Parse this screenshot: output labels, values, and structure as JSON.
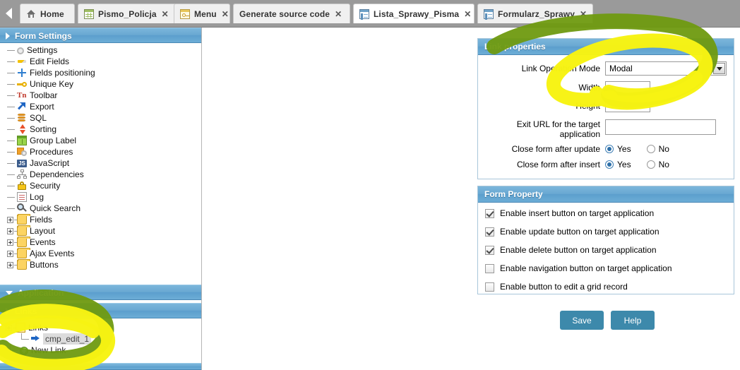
{
  "tabbar": {
    "scroll_left_icon": "triangle-left-icon",
    "tabs": [
      {
        "label": "Home",
        "icon": "home-icon",
        "closable": false,
        "active": false
      },
      {
        "label": "Pismo_Policja",
        "icon": "grid-icon",
        "closable": true,
        "active": false
      },
      {
        "label": "Menu",
        "icon": "menu-icon",
        "closable": true,
        "active": false
      },
      {
        "label": "Generate source code",
        "icon": "none",
        "closable": true,
        "active": false
      },
      {
        "label": "Lista_Sprawy_Pisma",
        "icon": "form-icon",
        "closable": true,
        "active": true
      },
      {
        "label": "Formularz_Sprawy",
        "icon": "form-icon",
        "closable": true,
        "active": false
      }
    ],
    "close_glyph": "✕"
  },
  "sidebar": {
    "sections": [
      {
        "title": "Form Settings",
        "expanded": true
      },
      {
        "title": "Application",
        "expanded": true
      },
      {
        "title": "Links",
        "expanded": false
      }
    ],
    "form_settings_items": [
      {
        "label": "Settings",
        "icon": "gear-icon",
        "type": "leaf"
      },
      {
        "label": "Edit Fields",
        "icon": "pencil-icon",
        "type": "leaf"
      },
      {
        "label": "Fields positioning",
        "icon": "move-icon",
        "type": "leaf"
      },
      {
        "label": "Unique Key",
        "icon": "key-icon",
        "type": "leaf"
      },
      {
        "label": "Toolbar",
        "icon": "toolbar-icon",
        "type": "leaf"
      },
      {
        "label": "Export",
        "icon": "export-arrow-icon",
        "type": "leaf"
      },
      {
        "label": "SQL",
        "icon": "database-icon",
        "type": "leaf"
      },
      {
        "label": "Sorting",
        "icon": "sort-icon",
        "type": "leaf"
      },
      {
        "label": "Group Label",
        "icon": "group-label-icon",
        "type": "leaf"
      },
      {
        "label": "Procedures",
        "icon": "procedures-icon",
        "type": "leaf"
      },
      {
        "label": "JavaScript",
        "icon": "javascript-icon",
        "type": "leaf"
      },
      {
        "label": "Dependencies",
        "icon": "dependencies-icon",
        "type": "leaf"
      },
      {
        "label": "Security",
        "icon": "lock-icon",
        "type": "leaf"
      },
      {
        "label": "Log",
        "icon": "log-icon",
        "type": "leaf"
      },
      {
        "label": "Quick Search",
        "icon": "magnifier-icon",
        "type": "leaf"
      },
      {
        "label": "Fields",
        "icon": "folder-icon",
        "type": "folder"
      },
      {
        "label": "Layout",
        "icon": "folder-icon",
        "type": "folder"
      },
      {
        "label": "Events",
        "icon": "folder-icon",
        "type": "folder"
      },
      {
        "label": "Ajax Events",
        "icon": "folder-icon",
        "type": "folder"
      },
      {
        "label": "Buttons",
        "icon": "folder-icon",
        "type": "folder"
      }
    ],
    "links_items": [
      {
        "label": "Links",
        "icon": "folder-open-icon",
        "type": "folder",
        "selected": false
      },
      {
        "label": "cmp_edit_1",
        "icon": "blue-arrow-icon",
        "type": "leaf",
        "selected": true
      },
      {
        "label": "New Link",
        "icon": "plus-circle-green-icon",
        "type": "leaf",
        "selected": false
      }
    ]
  },
  "link_properties": {
    "title": "Link properties",
    "operation_mode_label": "Link Operation Mode",
    "operation_mode_value": "Modal",
    "width_label": "Width",
    "width_value": "",
    "height_label": "Height",
    "height_value": "",
    "exit_url_label_line1": "Exit URL for the target",
    "exit_url_label_line2": "application",
    "exit_url_value": "",
    "close_after_update_label": "Close form after update",
    "close_after_update_value": "Yes",
    "close_after_insert_label": "Close form after insert",
    "close_after_insert_value": "Yes",
    "yes_label": "Yes",
    "no_label": "No"
  },
  "form_property": {
    "title": "Form Property",
    "options": [
      {
        "label": "Enable insert button on target application",
        "checked": true
      },
      {
        "label": "Enable update button on target application",
        "checked": true
      },
      {
        "label": "Enable delete button on target application",
        "checked": true
      },
      {
        "label": "Enable navigation button on target application",
        "checked": false
      },
      {
        "label": "Enable button to edit a grid record",
        "checked": false
      }
    ]
  },
  "actions": {
    "save_label": "Save",
    "help_label": "Help"
  },
  "annotations": {
    "highlight_color_yellow": "#f7f312",
    "highlight_color_green": "#6f9a10",
    "description": "hand-drawn highlighter circles around Links tree node and Link properties panel"
  },
  "colors": {
    "accent_blue": "#5b9ecd",
    "button_blue": "#3d89ab",
    "tabbar_gray": "#9a9a9a"
  }
}
